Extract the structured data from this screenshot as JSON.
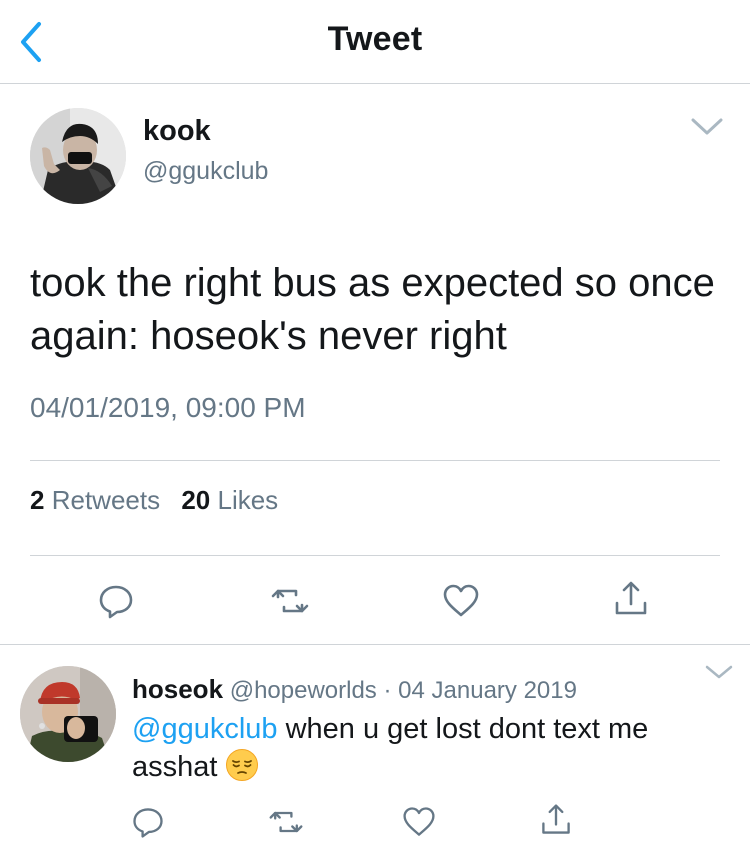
{
  "header": {
    "title": "Tweet",
    "back_icon": "chevron-left-icon"
  },
  "tweet": {
    "author_name": "kook",
    "author_handle": "@ggukclub",
    "text": "took the right bus as expected so once again: hoseok's never right",
    "timestamp": "04/01/2019, 09:00 PM",
    "retweet_count": "2",
    "retweet_label": "Retweets",
    "like_count": "20",
    "like_label": "Likes"
  },
  "reply": {
    "author_name": "hoseok",
    "author_handle": "@hopeworlds",
    "separator": "·",
    "date": "04 January 2019",
    "mention": "@ggukclub",
    "text": "when u get lost dont text me asshat",
    "emoji": "pensive-face"
  },
  "colors": {
    "accent": "#1da1f2",
    "muted": "#657786",
    "text": "#14171a",
    "divider": "#d0d4d8"
  }
}
